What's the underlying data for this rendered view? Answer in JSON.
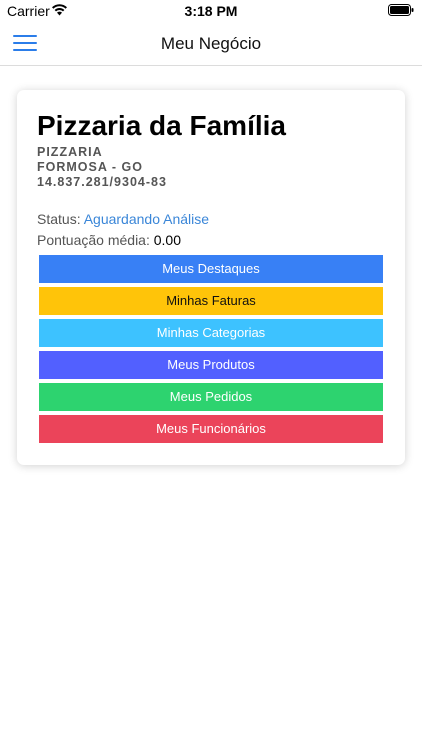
{
  "status_bar": {
    "carrier": "Carrier",
    "time": "3:18 PM",
    "icons": [
      "wifi-icon",
      "battery-icon"
    ]
  },
  "nav": {
    "title": "Meu Negócio",
    "menu_icon": "hamburger-menu-icon"
  },
  "business": {
    "name": "Pizzaria da Família",
    "category": "PIZZARIA",
    "location": "FORMOSA - GO",
    "document": "14.837.281/9304-83",
    "status_label": "Status: ",
    "status_value": "Aguardando Análise",
    "rating_label": "Pontuação média: ",
    "rating_value": "0.00"
  },
  "actions": {
    "destaques": "Meus Destaques",
    "faturas": "Minhas Faturas",
    "categorias": "Minhas Categorias",
    "produtos": "Meus Produtos",
    "pedidos": "Meus Pedidos",
    "funcionarios": "Meus Funcionários"
  },
  "colors": {
    "primary": "#3880f5",
    "warning": "#ffc409",
    "secondary": "#3dc2ff",
    "tertiary": "#5260ff",
    "success": "#2dd36f",
    "danger": "#eb445a",
    "link": "#3a86d8"
  }
}
